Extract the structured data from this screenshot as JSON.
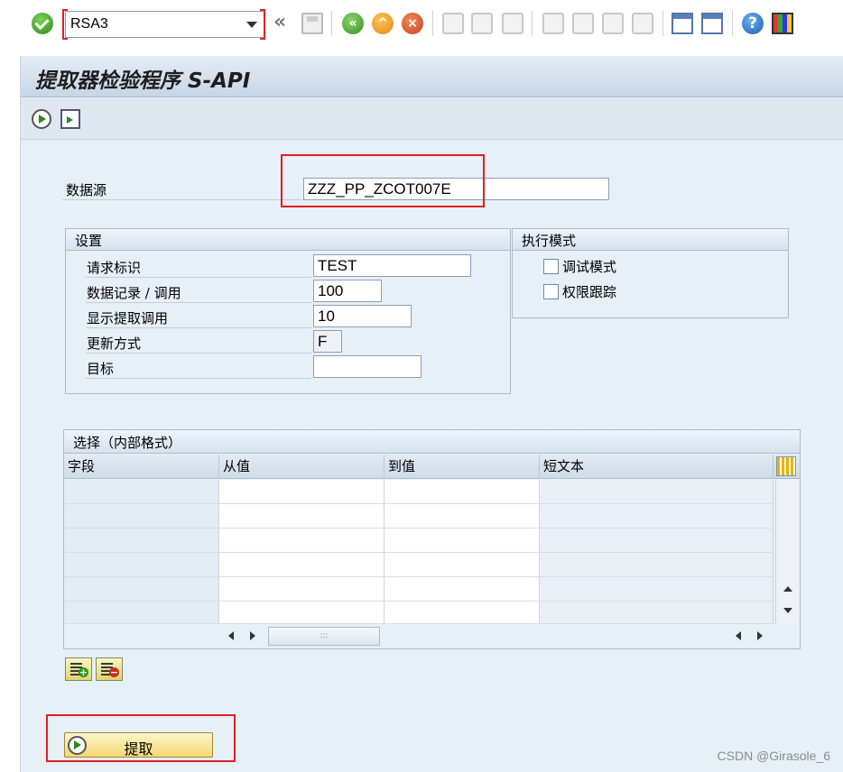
{
  "toolbar": {
    "command_field_value": "RSA3",
    "icons": [
      "enter-icon",
      "command-dropdown-icon",
      "back-double-icon",
      "save-icon",
      "back-icon",
      "exit-icon",
      "cancel-icon",
      "print-icon",
      "find-icon",
      "find-next-icon",
      "first-page-icon",
      "previous-page-icon",
      "next-page-icon",
      "last-page-icon",
      "create-session-icon",
      "generate-shortcut-icon",
      "help-icon",
      "customize-layout-icon"
    ]
  },
  "screen": {
    "title": "提取器检验程序 S-API",
    "app_toolbar_icons": [
      "execute-icon",
      "document-icon"
    ]
  },
  "datasource": {
    "label": "数据源",
    "value": "ZZZ_PP_ZCOT007E"
  },
  "settings": {
    "title": "设置",
    "fields": [
      {
        "label": "请求标识",
        "value": "TEST"
      },
      {
        "label": "数据记录 / 调用",
        "value": "100"
      },
      {
        "label": "显示提取调用",
        "value": "10"
      },
      {
        "label": "更新方式",
        "value": "F"
      },
      {
        "label": "目标",
        "value": ""
      }
    ]
  },
  "exec_mode": {
    "title": "执行模式",
    "options": [
      {
        "label": "调试模式",
        "checked": false
      },
      {
        "label": "权限跟踪",
        "checked": false
      }
    ]
  },
  "selection": {
    "title": "选择（内部格式）",
    "columns": [
      "字段",
      "从值",
      "到值",
      "短文本"
    ],
    "row_count": 6
  },
  "buttons": {
    "extract_label": "提取"
  },
  "watermark": "CSDN @Girasole_6",
  "colors": {
    "highlight_red": "#e02020",
    "frame_background": "#e7eff7",
    "button_yellow": "#f3d873"
  }
}
